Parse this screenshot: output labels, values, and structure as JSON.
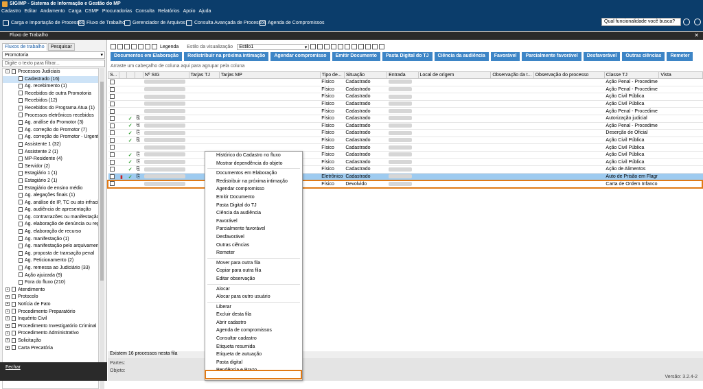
{
  "window": {
    "title": "SIG/MP - Sistema de Informação e Gestão do MP"
  },
  "menu": [
    "Cadastro",
    "Editar",
    "Andamento",
    "Carga",
    "CSMP",
    "Procuradorias",
    "Consulta",
    "Relatórios",
    "Apoio",
    "Ajuda"
  ],
  "toolbar": {
    "items": [
      "Carga e Importação de Processos",
      "Fluxo de Trabalho",
      "Gerenciador de Arquivos",
      "Consulta Avançada de Processos",
      "Agenda de Compromissos"
    ],
    "search_value": "Qual funcionalidade você busca?"
  },
  "panel": {
    "title": "Fluxo de Trabalho"
  },
  "left": {
    "tabs": [
      "Fluxos de trabalho",
      "Pesquisar"
    ],
    "combo_value": "Promotoria",
    "filter_placeholder": "Digite o texto para filtrar...",
    "close_label": "Fechar",
    "tree_root": "Processos Judiciais",
    "tree_children": [
      "Cadastrado (16)",
      "Ag. recebimento (1)",
      "Recebidos de outra Promotoria",
      "Recebidos (12)",
      "Recebidos do Programa Atua (1)",
      "Processos eletrônicos recebidos",
      "Ag. análise do Promotor (3)",
      "Ag. correção do Promotor (7)",
      "Ag. correção do Promotor - Urgentes",
      "Assistente 1 (32)",
      "Assistente 2 (1)",
      "MP-Residente (4)",
      "Servidor (2)",
      "Estagiário 1 (1)",
      "Estagiário 2 (1)",
      "Estagiário de ensino médio",
      "Ag. alegações finais (1)",
      "Ag. análise de IP, TC ou ato infracional",
      "Ag. audiência de apresentação",
      "Ag. contrarrazões ou manifestação em",
      "Ag. elaboração de denúncia ou represe",
      "Ag. elaboração de recurso",
      "Ag. manifestação (1)",
      "Ag. manifestação pelo arquivamento",
      "Ag. proposta de transação penal",
      "Ag. Peticionamento (2)",
      "Ag. remessa ao Judiciário (33)",
      "Ação ajuizada (9)",
      "Fora do fluxo (210)"
    ],
    "tree_roots2": [
      "Atendimento",
      "Protocolo",
      "Notícia de Fato",
      "Procedimento Preparatório",
      "Inquérito Civil",
      "Procedimento Investigatório Criminal",
      "Procedimento Administrativo",
      "Solicitação",
      "Carta Precatória"
    ]
  },
  "right": {
    "legend_label": "Legenda",
    "estilo_label": "Estilo da visualização",
    "estilo_value": "Estilo1",
    "action_buttons": [
      "Documentos em Elaboração",
      "Redistribuir na próxima intimação",
      "Agendar compromisso",
      "Emitir Documento",
      "Pasta Digital do TJ",
      "Ciência da audiência",
      "Favorável",
      "Parcialmente favorável",
      "Desfavorável",
      "Outras ciências",
      "Remeter"
    ],
    "group_hint": "Arraste um cabeçalho de coluna aqui para agrupar pela coluna",
    "columns": [
      "S...",
      "",
      "",
      "",
      "Nº SIG",
      "Tarjas TJ",
      "Tarjas MP",
      "Tipo de...",
      "Situação",
      "Entrada",
      "Local de origem",
      "Observação da t...",
      "Observação do processo",
      "Classe TJ",
      "Vista"
    ],
    "rows": [
      {
        "tipo": "Físico",
        "situacao": "Cadastrado",
        "classe": "Ação Penal - Procedime",
        "check": false
      },
      {
        "tipo": "Físico",
        "situacao": "Cadastrado",
        "classe": "Ação Penal - Procedime",
        "check": false
      },
      {
        "tipo": "Físico",
        "situacao": "Cadastrado",
        "classe": "Ação Civil Pública",
        "check": false
      },
      {
        "tipo": "Físico",
        "situacao": "Cadastrado",
        "classe": "Ação Civil Pública",
        "check": false
      },
      {
        "tipo": "Físico",
        "situacao": "Cadastrado",
        "classe": "Ação Penal - Procedime",
        "check": false
      },
      {
        "tipo": "Físico",
        "situacao": "Cadastrado",
        "classe": "Autorização judicial",
        "check": true
      },
      {
        "tipo": "Físico",
        "situacao": "Cadastrado",
        "classe": "Ação Penal - Procedime",
        "check": true
      },
      {
        "tipo": "Físico",
        "situacao": "Cadastrado",
        "classe": "Deserção de Oficial",
        "check": true
      },
      {
        "tipo": "Físico",
        "situacao": "Cadastrado",
        "classe": "Ação Civil Pública",
        "check": true
      },
      {
        "tipo": "Físico",
        "situacao": "Cadastrado",
        "classe": "Ação Civil Pública",
        "check": false
      },
      {
        "tipo": "Físico",
        "situacao": "Cadastrado",
        "classe": "Ação Civil Pública",
        "check": true
      },
      {
        "tipo": "Físico",
        "situacao": "Cadastrado",
        "classe": "Ação Civil Pública",
        "check": true
      },
      {
        "tipo": "Físico",
        "situacao": "Cadastrado",
        "classe": "Ação de Alimentos",
        "check": true
      },
      {
        "tipo": "Eletrônico",
        "situacao": "Cadastrado",
        "classe": "Auto de Prisão em Flagr",
        "check": true,
        "selected": true
      },
      {
        "tipo": "Físico",
        "situacao": "Devolvido",
        "classe": "Carta de Ordem Infanco",
        "check": false
      }
    ],
    "footer_count": "Existem 16 processos nesta fila",
    "partes_label": "Partes:",
    "objeto_label": "Objeto:",
    "version": "Versão: 3.2.4-2"
  },
  "context_menu": [
    "Histórico do Cadastro no fluxo",
    "Mostrar dependência do objeto",
    "---",
    "Documentos em Elaboração",
    "Redistribuir na próxima intimação",
    "Agendar compromisso",
    "Emitir Documento",
    "Pasta Digital do TJ",
    "Ciência da audiência",
    "Favorável",
    "Parcialmente favorável",
    "Desfavorável",
    "Outras ciências",
    "Remeter",
    "---",
    "Mover para outra fila",
    "Copiar para outra fila",
    "Editar observação",
    "---",
    "Alocar",
    "Alocar para outro usuário",
    "---",
    "Liberar",
    "Excluir desta fila",
    "Abrir cadastro",
    "Agenda de compromissos",
    "Consultar cadastro",
    "Etiqueta resumida",
    "Etiqueta de autuação",
    "Pasta digital",
    "Pendência e Prazo"
  ]
}
